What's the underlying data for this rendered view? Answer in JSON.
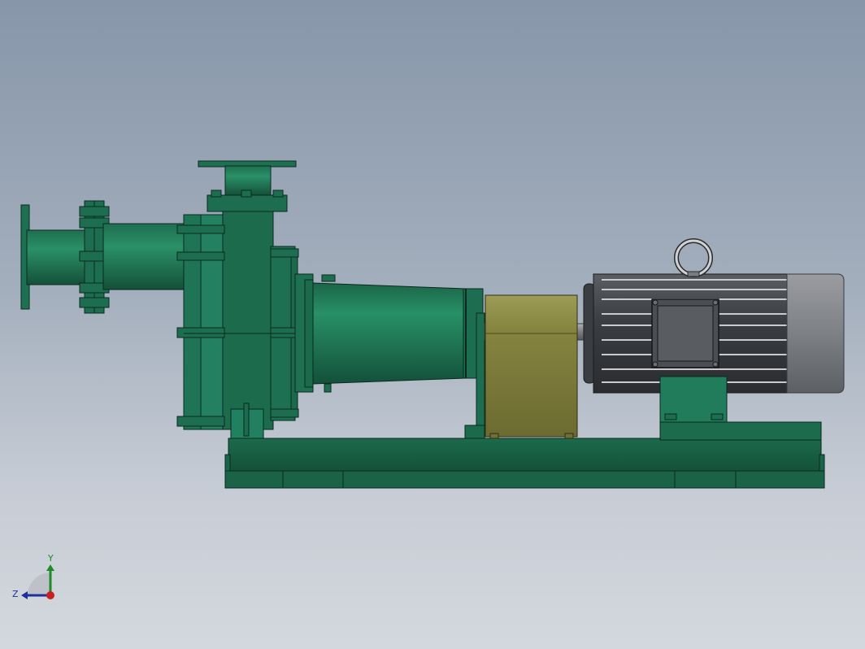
{
  "view": {
    "background_top": "#8796aa",
    "background_bottom": "#d4d8de"
  },
  "colors": {
    "pump_green": "#217a5a",
    "pump_green_dark": "#0f4a34",
    "pump_green_light": "#2e9470",
    "coupling_guard": "#7d7c40",
    "coupling_guard_light": "#9a9950",
    "motor_dark": "#4a4d52",
    "motor_light": "#8c8f94",
    "lifting_eye": "#c8cacc"
  },
  "triad": {
    "y_label": "Y",
    "z_label": "Z",
    "y_color": "#1e8a2a",
    "z_color": "#1d2f9a",
    "x_color": "#c8201e"
  }
}
